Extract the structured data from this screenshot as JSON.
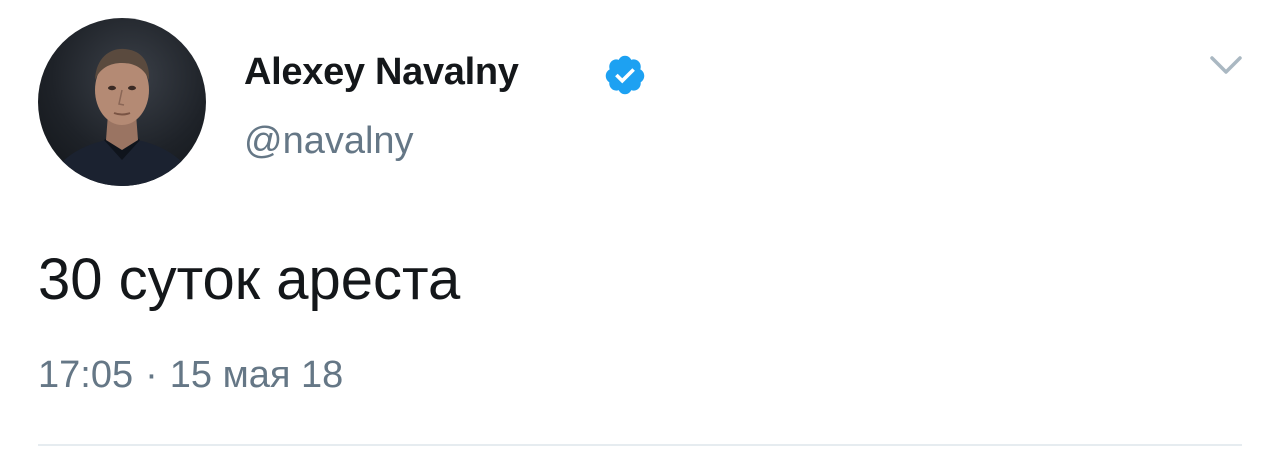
{
  "author": {
    "name": "Alexey Navalny",
    "handle": "@navalny",
    "verified": true
  },
  "tweet": {
    "text": "30 суток ареста",
    "time": "17:05",
    "separator": "·",
    "date": "15 мая 18"
  },
  "colors": {
    "text_primary": "#14171a",
    "text_secondary": "#657786",
    "verified_blue": "#1da1f2",
    "divider": "#e6ecf0"
  },
  "icons": {
    "verified": "verified-badge-icon",
    "menu": "chevron-down-icon"
  }
}
